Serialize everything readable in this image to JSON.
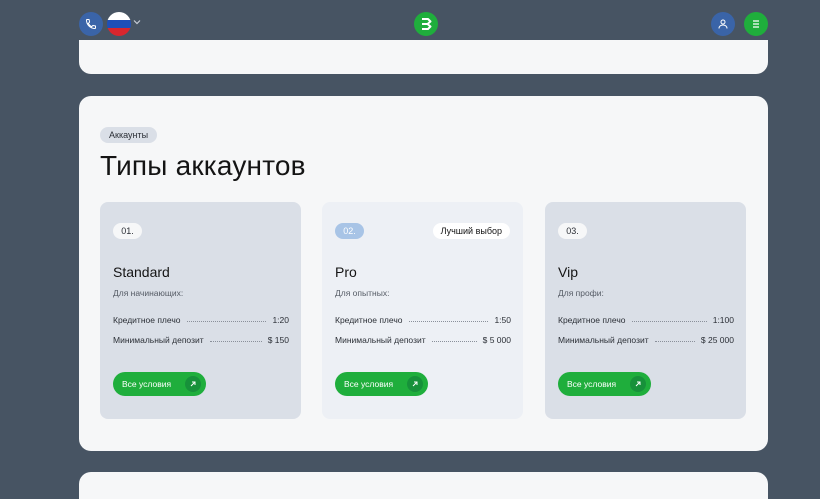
{
  "header": {
    "phone_icon": "phone-icon",
    "flag_icon": "russia-flag-icon",
    "logo_icon": "brand-logo-icon",
    "user_icon": "user-icon",
    "menu_icon": "menu-icon"
  },
  "section": {
    "chip": "Аккаунты",
    "title": "Типы аккаунтов"
  },
  "cards": [
    {
      "num": "01.",
      "badge": "",
      "name": "Standard",
      "sub": "Для начинающих:",
      "leverage_label": "Кредитное плечо",
      "leverage_value": "1:20",
      "deposit_label": "Минимальный депозит",
      "deposit_value": "$ 150",
      "cta": "Все условия"
    },
    {
      "num": "02.",
      "badge": "Лучший выбор",
      "name": "Pro",
      "sub": "Для опытных:",
      "leverage_label": "Кредитное плечо",
      "leverage_value": "1:50",
      "deposit_label": "Минимальный депозит",
      "deposit_value": "$ 5 000",
      "cta": "Все условия"
    },
    {
      "num": "03.",
      "badge": "",
      "name": "Vip",
      "sub": "Для профи:",
      "leverage_label": "Кредитное плечо",
      "leverage_value": "1:100",
      "deposit_label": "Минимальный депозит",
      "deposit_value": "$ 25 000",
      "cta": "Все условия"
    }
  ],
  "colors": {
    "background": "#475463",
    "accent_green": "#1fae3c",
    "accent_blue": "#3a64a8",
    "card_bg": "#dadfe7",
    "card_highlight_bg": "#edf0f5"
  }
}
